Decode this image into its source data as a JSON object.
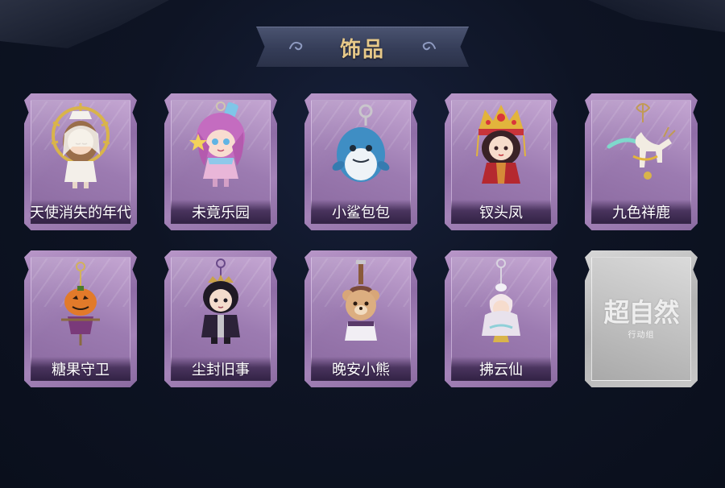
{
  "header": {
    "title": "饰品"
  },
  "items": [
    {
      "name": "天使消失的年代",
      "icon": "angel-doll-charm-icon"
    },
    {
      "name": "未竟乐园",
      "icon": "pink-hair-doll-charm-icon"
    },
    {
      "name": "小鲨包包",
      "icon": "blue-shark-charm-icon"
    },
    {
      "name": "钗头凤",
      "icon": "phoenix-crown-doll-charm-icon"
    },
    {
      "name": "九色祥鹿",
      "icon": "white-deer-charm-icon"
    },
    {
      "name": "糖果守卫",
      "icon": "pumpkin-scarecrow-charm-icon"
    },
    {
      "name": "尘封旧事",
      "icon": "dark-hair-doll-charm-icon"
    },
    {
      "name": "晚安小熊",
      "icon": "teddy-bear-charm-icon"
    },
    {
      "name": "拂云仙",
      "icon": "cloud-fairy-charm-icon"
    }
  ],
  "locked_item": {
    "watermark": "超自然",
    "watermark_sub": "行动组"
  },
  "colors": {
    "title_gold": "#e7c989",
    "card_purple": "#9c7bb1",
    "background": "#0e1424"
  }
}
